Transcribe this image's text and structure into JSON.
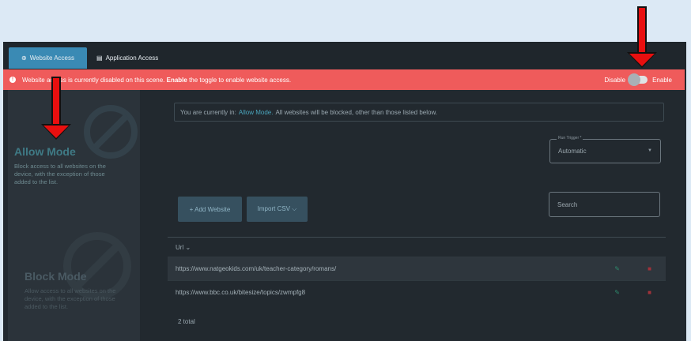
{
  "tabs": [
    {
      "label": "Website Access",
      "icon": "globe-icon"
    },
    {
      "label": "Application Access",
      "icon": "window-icon"
    }
  ],
  "alert": {
    "text_before": "Website access is currently disabled on this scene. ",
    "bold": "Enable",
    "text_after": " the toggle to enable website access.",
    "color": "#ef5b5b"
  },
  "toggle": {
    "off_label": "Disable",
    "on_label": "Enable",
    "state": "off"
  },
  "modes": [
    {
      "title": "Allow Mode",
      "desc": "Block access to all websites on the device, with the exception of those added to the list."
    },
    {
      "title": "Block Mode",
      "desc": "Allow access to all websites on the device, with the exception of those added to the list."
    }
  ],
  "info": {
    "prefix": "You are currently in:",
    "mode": "Allow Mode.",
    "suffix": "All websites will be blocked, other than those listed below."
  },
  "run_trigger": {
    "label": "Run Trigger *",
    "value": "Automatic"
  },
  "buttons": {
    "add": "+  Add Website",
    "import": "Import CSV  ⌵"
  },
  "search": {
    "placeholder": "Search"
  },
  "table": {
    "header": "Url ⌄",
    "rows": [
      "https://www.natgeokids.com/uk/teacher-category/romans/",
      "https://www.bbc.co.uk/bitesize/topics/zwmpfg8"
    ],
    "total": "2 total"
  }
}
